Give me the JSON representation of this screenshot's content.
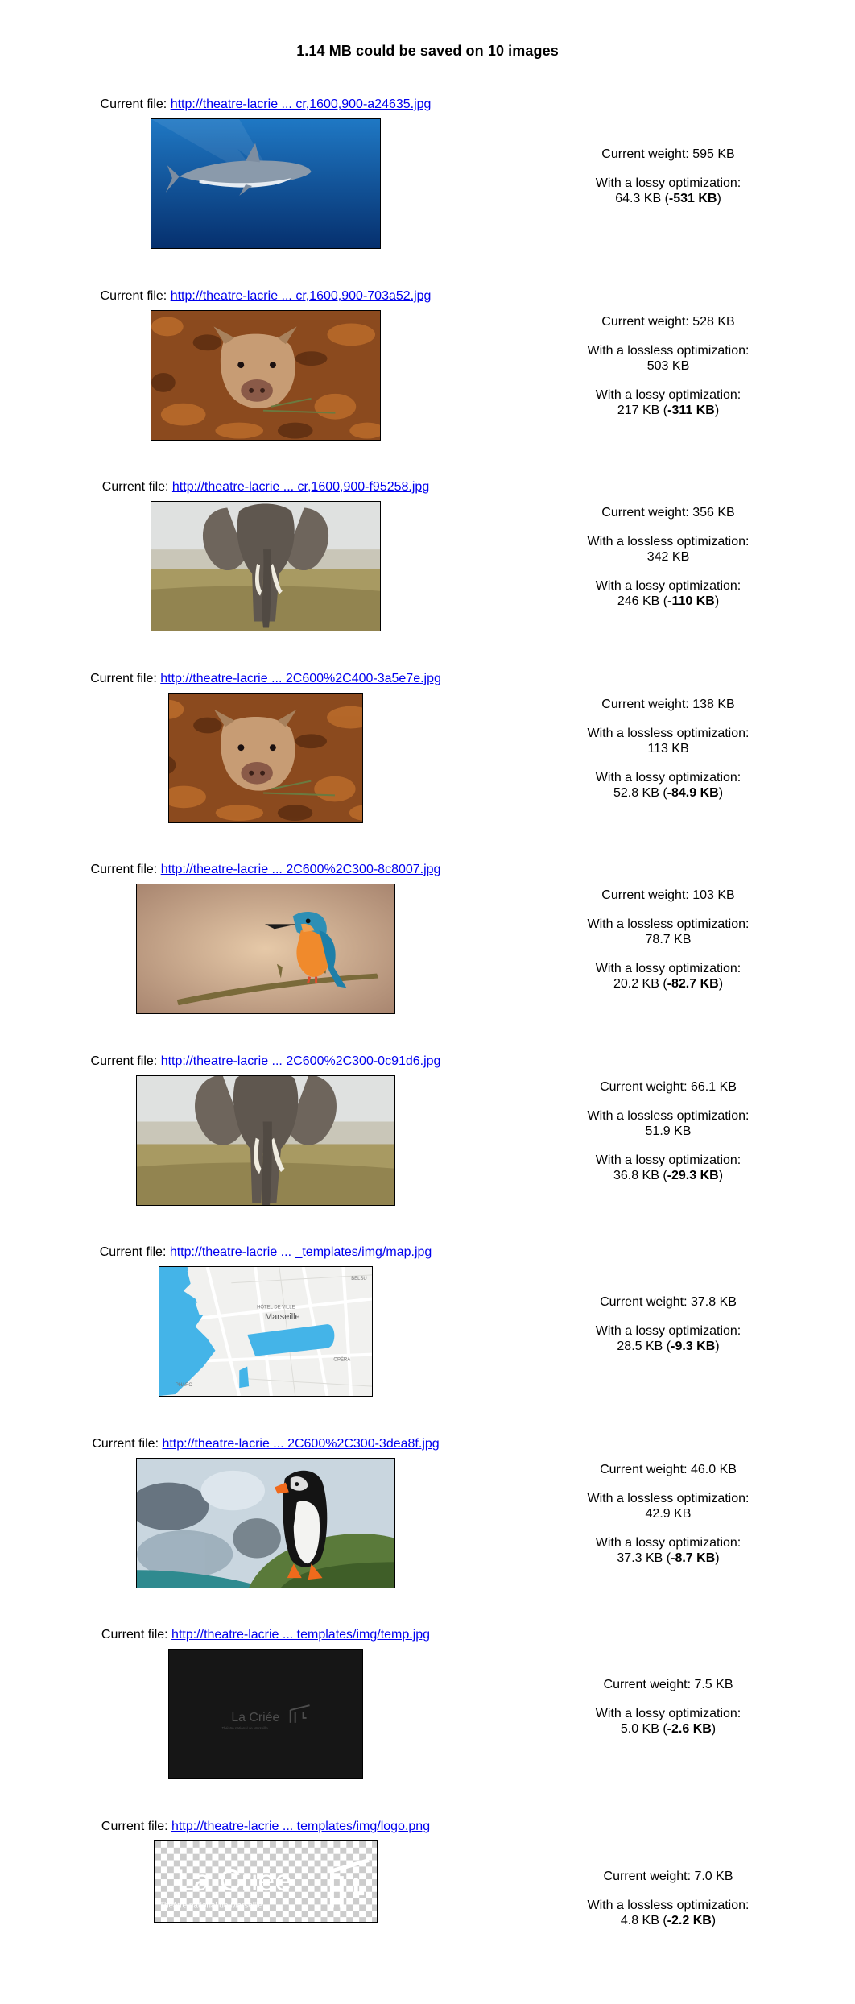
{
  "header": {
    "title": "1.14 MB could be saved on 10 images"
  },
  "labels": {
    "current_file": "Current file: ",
    "current_weight": "Current weight: ",
    "lossless": "With a lossless optimization:",
    "lossy": "With a lossy optimization:"
  },
  "images": [
    {
      "link": "http://theatre-lacrie ... cr,1600,900-a24635.jpg",
      "picture": "shark",
      "current_weight": "595 KB",
      "lossless": null,
      "lossy": "64.3 KB",
      "saving": "-531 KB"
    },
    {
      "link": "http://theatre-lacrie ... cr,1600,900-703a52.jpg",
      "picture": "boar",
      "current_weight": "528 KB",
      "lossless": "503 KB",
      "lossy": "217 KB",
      "saving": "-311 KB"
    },
    {
      "link": "http://theatre-lacrie ... cr,1600,900-f95258.jpg",
      "picture": "elephant",
      "current_weight": "356 KB",
      "lossless": "342 KB",
      "lossy": "246 KB",
      "saving": "-110 KB"
    },
    {
      "link": "http://theatre-lacrie ... 2C600%2C400-3a5e7e.jpg",
      "picture": "boar",
      "current_weight": "138 KB",
      "lossless": "113 KB",
      "lossy": "52.8 KB",
      "saving": "-84.9 KB"
    },
    {
      "link": "http://theatre-lacrie ... 2C600%2C300-8c8007.jpg",
      "picture": "kingfisher",
      "current_weight": "103 KB",
      "lossless": "78.7 KB",
      "lossy": "20.2 KB",
      "saving": "-82.7 KB"
    },
    {
      "link": "http://theatre-lacrie ... 2C600%2C300-0c91d6.jpg",
      "picture": "elephant",
      "current_weight": "66.1 KB",
      "lossless": "51.9 KB",
      "lossy": "36.8 KB",
      "saving": "-29.3 KB"
    },
    {
      "link": "http://theatre-lacrie ... _templates/img/map.jpg",
      "picture": "map",
      "current_weight": "37.8 KB",
      "lossless": null,
      "lossy": "28.5 KB",
      "saving": "-9.3 KB"
    },
    {
      "link": "http://theatre-lacrie ... 2C600%2C300-3dea8f.jpg",
      "picture": "puffin",
      "current_weight": "46.0 KB",
      "lossless": "42.9 KB",
      "lossy": "37.3 KB",
      "saving": "-8.7 KB"
    },
    {
      "link": "http://theatre-lacrie ... templates/img/temp.jpg",
      "picture": "temp",
      "current_weight": "7.5 KB",
      "lossless": null,
      "lossy": "5.0 KB",
      "saving": "-2.6 KB"
    },
    {
      "link": "http://theatre-lacrie ... templates/img/logo.png",
      "picture": "logo",
      "current_weight": "7.0 KB",
      "lossless": "4.8 KB",
      "lossy": null,
      "saving": "-2.2 KB"
    }
  ],
  "map_text": {
    "city": "Marseille",
    "hotel": "HÔTEL DE VILLE",
    "belsu": "BELSU",
    "opera": "OPÉRA",
    "pharo": "PHARO"
  },
  "logo_text": {
    "brand": "La Criée",
    "subtitle": "Théâtre national de Marseille"
  }
}
